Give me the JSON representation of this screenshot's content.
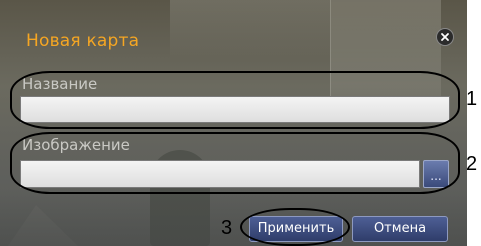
{
  "dialog": {
    "title": "Новая карта",
    "close_icon": "close-icon",
    "accent_color": "#f5a623"
  },
  "fields": {
    "name_label": "Название",
    "name_value": "",
    "image_label": "Изображение",
    "image_value": "",
    "browse_label": "..."
  },
  "buttons": {
    "apply_label": "Применить",
    "cancel_label": "Отмена"
  },
  "callouts": [
    "1",
    "2",
    "3"
  ]
}
